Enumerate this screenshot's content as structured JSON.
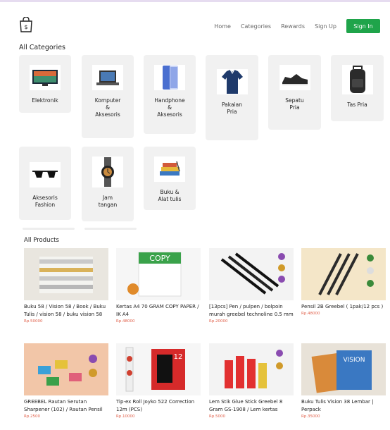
{
  "header": {
    "logo_icon": "shopping-bag-icon",
    "nav": [
      "Home",
      "Categories",
      "Rewards",
      "Sign Up"
    ],
    "signin_label": "Sign In",
    "accent": "#1fa44a"
  },
  "categories": {
    "title": "All Categories",
    "items": [
      {
        "label": "Elektronik",
        "icon": "tv-icon"
      },
      {
        "label": "Komputer\n&\nAksesoris",
        "icon": "laptop-icon"
      },
      {
        "label": "Handphone\n&\nAksesoris",
        "icon": "phone-icon"
      },
      {
        "label": "Pakaian\nPria",
        "icon": "shirt-icon"
      },
      {
        "label": "Sepatu\nPria",
        "icon": "shoe-icon"
      },
      {
        "label": "Tas Pria",
        "icon": "backpack-icon"
      },
      {
        "label": "Aksesoris\nFashion",
        "icon": "sunglasses-icon"
      },
      {
        "label": "Jam\ntangan",
        "icon": "watch-icon"
      },
      {
        "label": "Buku &\nAlat tulis",
        "icon": "books-icon"
      }
    ]
  },
  "products": {
    "title": "All Products",
    "items": [
      {
        "name": "Buku 58 / Vision 58 / Book / Buku Tulis / vision 58 / buku vision 58",
        "price": "Rp.50000",
        "icon": "notebook-stack-icon"
      },
      {
        "name": "Kertas A4 70 GRAM COPY PAPER / IK A4",
        "price": "Rp.48000",
        "icon": "paper-ream-icon"
      },
      {
        "name": "[13pcs] Pen / pulpen / bolpoin murah greebel technoline 0.5 mm",
        "price": "Rp.20000",
        "icon": "pens-icon"
      },
      {
        "name": "Pensil 2B Greebel ( 1pak/12 pcs )",
        "price": "Rp.48000",
        "icon": "pencils-icon"
      },
      {
        "name": "GREEBEL Rautan Serutan Sharpener (102) / Rautan Pensil",
        "price": "Rp.2500",
        "icon": "sharpener-icon"
      },
      {
        "name": "Tip-ex Roll Joyko 522 Correction 12m (PCS)",
        "price": "Rp.10000",
        "icon": "correction-tape-icon"
      },
      {
        "name": "Lem Stik Glue Stick Greebel 8 Gram GS-1908 / Lem kertas",
        "price": "Rp.5000",
        "icon": "glue-stick-icon"
      },
      {
        "name": "Buku Tulis Vision 38 Lembar | Perpack",
        "price": "Rp.35000",
        "icon": "notebook-pack-icon"
      }
    ]
  }
}
